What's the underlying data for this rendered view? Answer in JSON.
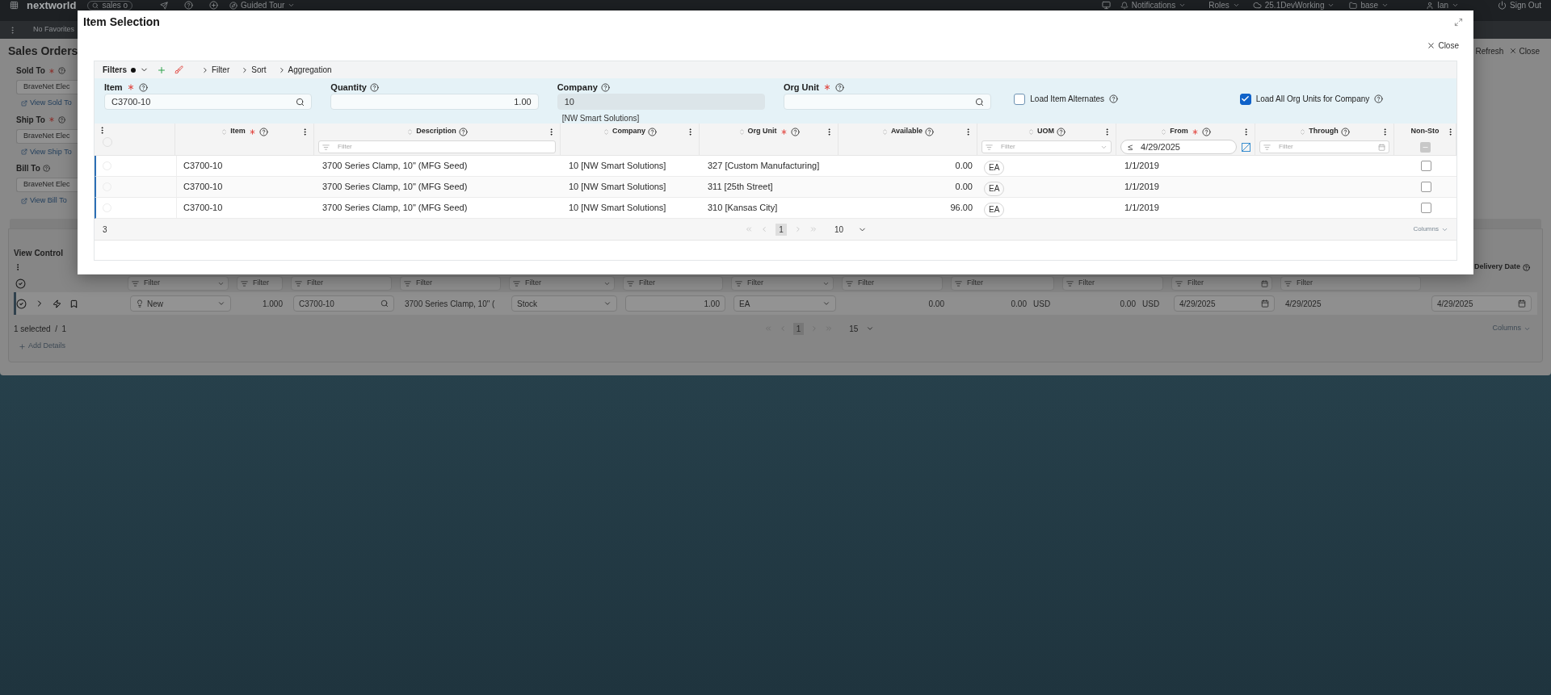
{
  "topbar": {
    "logo": "nextworld",
    "search": "sales o",
    "guided_tour": "Guided Tour",
    "notifications": "Notifications",
    "roles": "Roles",
    "environment": "25.1DevWorking",
    "branch": "base",
    "user": "Ian",
    "sign_out": "Sign Out"
  },
  "favorites": "No Favorites",
  "page": {
    "title": "Sales Orders",
    "refresh": "Refresh",
    "close": "Close"
  },
  "sections": [
    {
      "label": "Sold To",
      "required": true,
      "value": "BraveNet Elec",
      "link": "View Sold To"
    },
    {
      "label": "Ship To",
      "required": true,
      "value": "BraveNet Elec",
      "link": "View Ship To"
    },
    {
      "label": "Bill To",
      "required": false,
      "value": "BraveNet Elec",
      "link": "View Bill To"
    }
  ],
  "lines": {
    "title": "View Control",
    "last_header": "Delivery Date",
    "selected": true,
    "filters": [
      {
        "kind": "select",
        "placeholder": "Filter"
      },
      {
        "kind": "text",
        "placeholder": "Filter"
      },
      {
        "kind": "text",
        "placeholder": "Filter"
      },
      {
        "kind": "text",
        "placeholder": "Filter"
      },
      {
        "kind": "select",
        "placeholder": "Filter"
      },
      {
        "kind": "text",
        "placeholder": "Filter"
      },
      {
        "kind": "select",
        "placeholder": "Filter"
      },
      {
        "kind": "text",
        "placeholder": "Filter"
      },
      {
        "kind": "text",
        "placeholder": "Filter"
      },
      {
        "kind": "text",
        "placeholder": "Filter"
      },
      {
        "kind": "date",
        "placeholder": "Filter"
      },
      {
        "kind": "text",
        "placeholder": "Filter"
      },
      {
        "kind": "none"
      }
    ],
    "row": [
      {
        "kind": "status",
        "value": "New"
      },
      {
        "kind": "number",
        "value": "1.000"
      },
      {
        "kind": "search",
        "value": "C3700-10"
      },
      {
        "kind": "text",
        "value": "3700 Series Clamp, 10\" ("
      },
      {
        "kind": "select",
        "value": "Stock"
      },
      {
        "kind": "input",
        "value": "1.00"
      },
      {
        "kind": "select",
        "value": "EA"
      },
      {
        "kind": "amount",
        "value": "0.00"
      },
      {
        "kind": "amount",
        "value": "0.00",
        "currency": "USD"
      },
      {
        "kind": "amount",
        "value": "0.00",
        "currency": "USD"
      },
      {
        "kind": "date",
        "value": "4/29/2025"
      },
      {
        "kind": "text",
        "value": "4/29/2025"
      },
      {
        "kind": "date",
        "value": "4/29/2025"
      }
    ],
    "selection": "1 selected  /  1",
    "page": "1",
    "page_size": "15",
    "columns_button": "Columns",
    "add_details": "Add Details"
  },
  "modal": {
    "title": "Item Selection",
    "close": "Close",
    "filters_bar": {
      "label": "Filters",
      "links": [
        "Filter",
        "Sort",
        "Aggregation"
      ]
    },
    "fields": [
      {
        "kind": "search",
        "label": "Item",
        "required": true,
        "value": "C3700-10"
      },
      {
        "kind": "number",
        "label": "Quantity",
        "required": false,
        "value": "1.00"
      },
      {
        "kind": "readonly",
        "label": "Company",
        "required": false,
        "value": "10",
        "note": "[NW Smart Solutions]"
      },
      {
        "kind": "search",
        "label": "Org Unit",
        "required": true
      }
    ],
    "checkboxes": [
      {
        "label": "Load Item Alternates",
        "checked": false
      },
      {
        "label": "Load All Org Units for Company",
        "checked": true
      }
    ],
    "table": {
      "columns": [
        {
          "label": "Item",
          "required": true,
          "help": true,
          "kind": "text",
          "filter": {
            "kind": "none"
          }
        },
        {
          "label": "Description",
          "required": false,
          "help": true,
          "kind": "text",
          "filter": {
            "kind": "text",
            "placeholder": "Filter"
          }
        },
        {
          "label": "Company",
          "required": false,
          "help": true,
          "kind": "text",
          "filter": {
            "kind": "none"
          }
        },
        {
          "label": "Org Unit",
          "required": true,
          "help": true,
          "kind": "text",
          "filter": {
            "kind": "none"
          }
        },
        {
          "label": "Available",
          "required": false,
          "help": true,
          "kind": "number",
          "filter": {
            "kind": "none"
          }
        },
        {
          "label": "UOM",
          "required": false,
          "help": true,
          "kind": "badge",
          "filter": {
            "kind": "select",
            "placeholder": "Filter"
          }
        },
        {
          "label": "From",
          "required": true,
          "help": true,
          "kind": "text",
          "filter": {
            "kind": "date_op",
            "operator": "≤",
            "value": "4/29/2025"
          }
        },
        {
          "label": "Through",
          "required": false,
          "help": true,
          "kind": "text",
          "filter": {
            "kind": "date",
            "placeholder": "Filter"
          }
        },
        {
          "label": "Non-Sto",
          "required": false,
          "help": false,
          "kind": "check",
          "filter": {
            "kind": "check",
            "indeterminate": true
          }
        }
      ],
      "all_selected": false,
      "rows": [
        {
          "cells": [
            "C3700-10",
            "3700 Series Clamp, 10\" (MFG Seed)",
            "10 [NW Smart Solutions]",
            "327 [Custom Manufacturing]",
            "0.00",
            "EA",
            "1/1/2019",
            null,
            false
          ]
        },
        {
          "cells": [
            "C3700-10",
            "3700 Series Clamp, 10\" (MFG Seed)",
            "10 [NW Smart Solutions]",
            "311 [25th Street]",
            "0.00",
            "EA",
            "1/1/2019",
            null,
            false
          ]
        },
        {
          "cells": [
            "C3700-10",
            "3700 Series Clamp, 10\" (MFG Seed)",
            "10 [NW Smart Solutions]",
            "310 [Kansas City]",
            "96.00",
            "EA",
            "1/1/2019",
            null,
            false
          ]
        }
      ],
      "count": "3",
      "page": "1",
      "page_size": "10",
      "columns_button": "Columns"
    }
  }
}
